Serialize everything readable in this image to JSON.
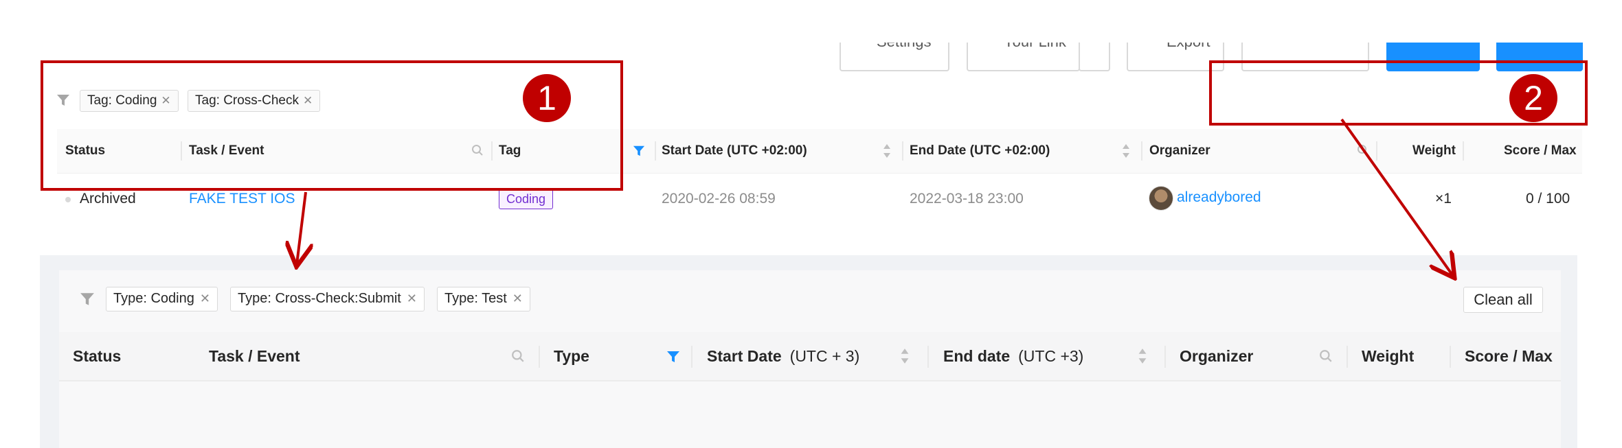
{
  "toolbar": {
    "settings_label": "Settings",
    "your_link_label": "Your Link",
    "export_label": "Export"
  },
  "filter_top": {
    "tags": [
      "Tag: Coding",
      "Tag: Cross-Check"
    ]
  },
  "table_top": {
    "headers": {
      "status": "Status",
      "task": "Task / Event",
      "tag": "Tag",
      "start": "Start Date (UTC +02:00)",
      "end": "End Date (UTC +02:00)",
      "organizer": "Organizer",
      "weight": "Weight",
      "score": "Score / Max"
    },
    "row": {
      "status": "Archived",
      "task": "FAKE TEST IOS",
      "tag": "Coding",
      "start": "2020-02-26 08:59",
      "end": "2022-03-18 23:00",
      "organizer": "alreadybored",
      "weight": "×1",
      "score": "0 / 100"
    }
  },
  "filter_bottom": {
    "tags": [
      "Type: Coding",
      "Type: Cross-Check:Submit",
      "Type: Test"
    ],
    "clear_all": "Clean all"
  },
  "table_bottom": {
    "headers": {
      "status": "Status",
      "task": "Task / Event",
      "type": "Type",
      "start": "Start Date",
      "start_tz": "(UTC + 3)",
      "end": "End date",
      "end_tz": "(UTC +3)",
      "organizer": "Organizer",
      "weight": "Weight",
      "score": "Score / Max"
    }
  },
  "annotations": {
    "badge1": "1",
    "badge2": "2"
  },
  "colors": {
    "accent": "#1890ff",
    "annotation": "#c00000",
    "tag_purple": "#722ed1"
  }
}
